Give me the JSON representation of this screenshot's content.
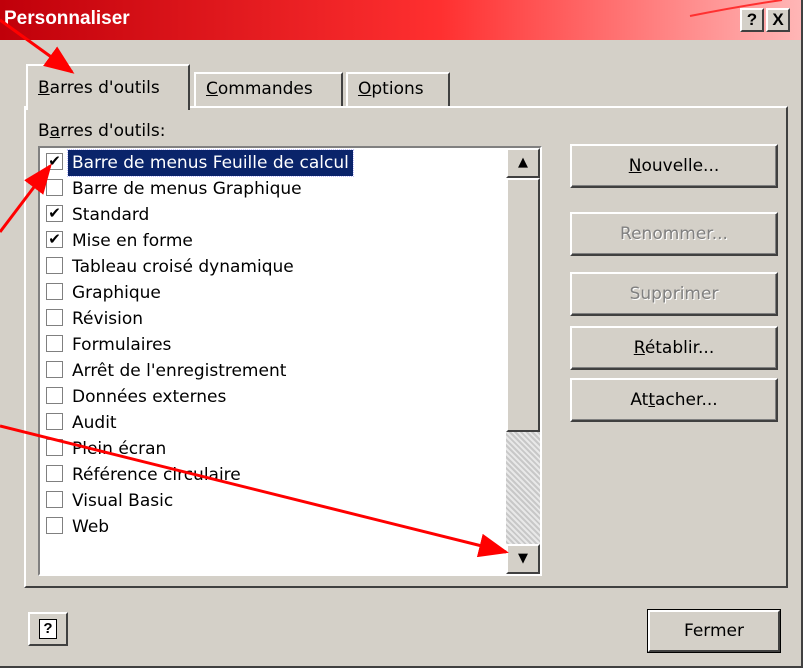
{
  "window": {
    "title": "Personnaliser",
    "help_glyph": "?",
    "close_glyph": "X"
  },
  "tabs": [
    {
      "label": "Barres d'outils",
      "active": true
    },
    {
      "label": "Commandes",
      "active": false
    },
    {
      "label": "Options",
      "active": false
    }
  ],
  "toolbars": {
    "list_label": "Barres d'outils:",
    "items": [
      {
        "label": "Barre de menus Feuille de calcul",
        "checked": true,
        "selected": true
      },
      {
        "label": "Barre de menus Graphique",
        "checked": false
      },
      {
        "label": "Standard",
        "checked": true
      },
      {
        "label": "Mise en forme",
        "checked": true
      },
      {
        "label": "Tableau croisé dynamique",
        "checked": false
      },
      {
        "label": "Graphique",
        "checked": false
      },
      {
        "label": "Révision",
        "checked": false
      },
      {
        "label": "Formulaires",
        "checked": false
      },
      {
        "label": "Arrêt de l'enregistrement",
        "checked": false
      },
      {
        "label": "Données externes",
        "checked": false
      },
      {
        "label": "Audit",
        "checked": false
      },
      {
        "label": "Plein écran",
        "checked": false
      },
      {
        "label": "Référence circulaire",
        "checked": false
      },
      {
        "label": "Visual Basic",
        "checked": false
      },
      {
        "label": "Web",
        "checked": false
      }
    ]
  },
  "buttons": {
    "new": "Nouvelle...",
    "rename": "Renommer...",
    "delete": "Supprimer",
    "reset": "Rétablir...",
    "attach": "Attacher...",
    "close": "Fermer"
  },
  "colors": {
    "title_gradient_start": "#c0000a",
    "selection": "#0a246a",
    "annotation_arrow": "#ff0000",
    "dialog_face": "#d4d0c8"
  },
  "icons": {
    "scroll_up": "arrow-up-icon",
    "scroll_down": "arrow-down-icon",
    "help": "help-question-icon"
  }
}
